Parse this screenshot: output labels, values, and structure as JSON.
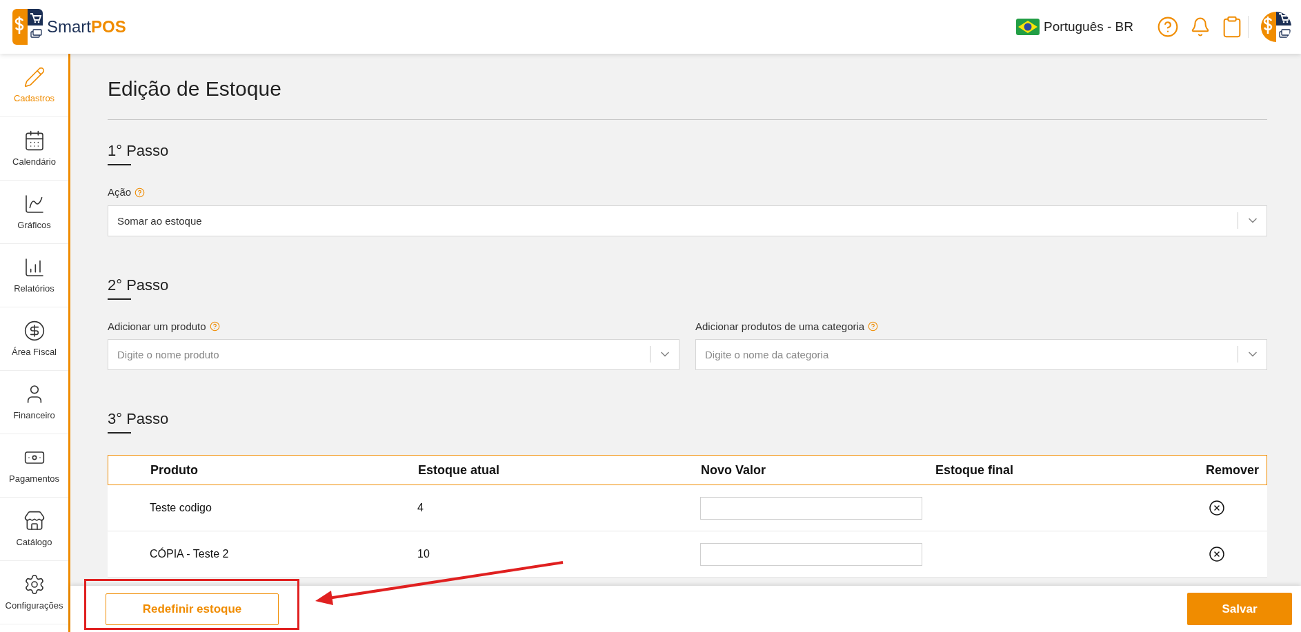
{
  "header": {
    "logo": {
      "text_1": "Smart",
      "text_2": "POS"
    },
    "language": "Português - BR"
  },
  "sidebar": {
    "items": [
      {
        "kind": "pencil",
        "label": "Cadastros",
        "selected": true
      },
      {
        "kind": "calendar",
        "label": "Calendário",
        "selected": false
      },
      {
        "kind": "line-chart",
        "label": "Gráficos",
        "selected": false
      },
      {
        "kind": "bar-chart",
        "label": "Relatórios",
        "selected": false
      },
      {
        "kind": "dollar",
        "label": "Área Fiscal",
        "selected": false
      },
      {
        "kind": "person",
        "label": "Financeiro",
        "selected": false
      },
      {
        "kind": "banknote",
        "label": "Pagamentos",
        "selected": false
      },
      {
        "kind": "store",
        "label": "Catálogo",
        "selected": false
      },
      {
        "kind": "gear",
        "label": "Configurações",
        "selected": false
      }
    ]
  },
  "page": {
    "title": "Edição de Estoque",
    "step_1": {
      "title": "1° Passo",
      "field": {
        "label": "Ação",
        "value": "Somar ao estoque"
      }
    },
    "step_2": {
      "title": "2° Passo",
      "fields": [
        {
          "label": "Adicionar um produto",
          "placeholder": "Digite o nome produto"
        },
        {
          "label": "Adicionar produtos de uma categoria",
          "placeholder": "Digite o nome da categoria"
        }
      ]
    },
    "step_3": {
      "title": "3° Passo",
      "table": {
        "columns": [
          "Produto",
          "Estoque atual",
          "Novo Valor",
          "Estoque final",
          "Remover"
        ],
        "rows": [
          {
            "product": "Teste codigo",
            "current_stock": "4"
          },
          {
            "product": "CÓPIA - Teste 2",
            "current_stock": "10"
          }
        ]
      }
    }
  },
  "footer": {
    "reset_button": "Redefinir estoque",
    "save_button": "Salvar"
  }
}
